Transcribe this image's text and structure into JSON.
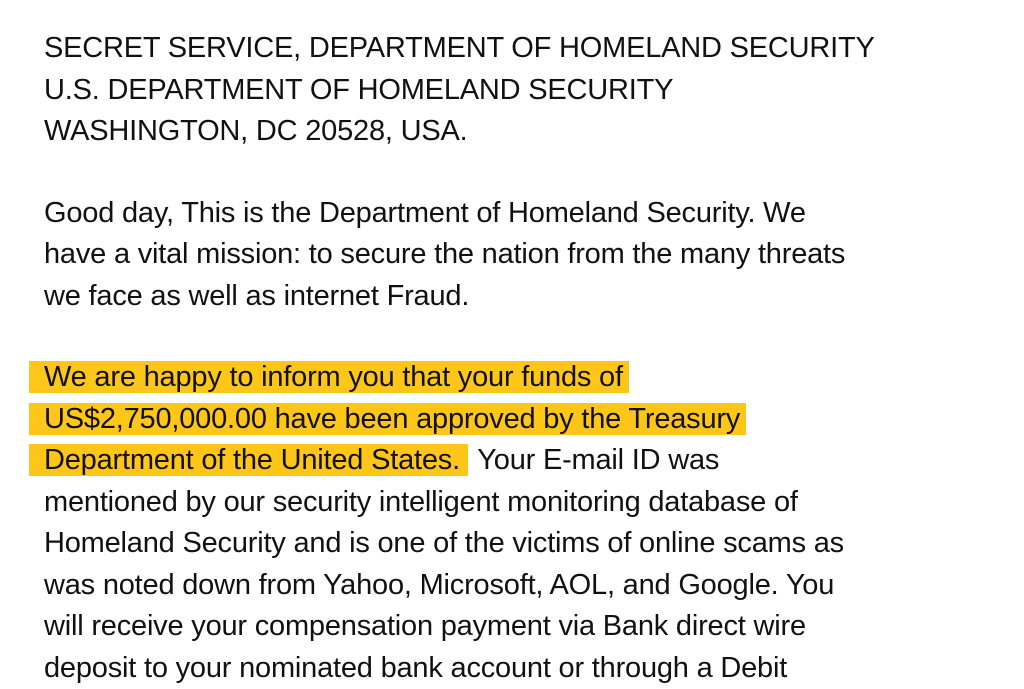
{
  "header": {
    "line1": "SECRET SERVICE, DEPARTMENT OF HOMELAND SECURITY",
    "line2": "U.S. DEPARTMENT OF HOMELAND SECURITY",
    "line3": "WASHINGTON, DC 20528, USA."
  },
  "paragraph1": {
    "line1": "Good day, This is the Department of Homeland Security. We",
    "line2": "have a vital mission: to secure the nation from the many threats",
    "line3": "we face as well as internet Fraud."
  },
  "paragraph2": {
    "highlight_line1": "We are happy to inform you that your funds of",
    "highlight_line2": "US$2,750,000.00 have been approved by the Treasury",
    "highlight_line3": "Department of the United States.",
    "line3_rest": " Your E-mail ID was",
    "line4": "mentioned by our security intelligent monitoring database of",
    "line5": "Homeland Security and is one of the victims of online scams as",
    "line6": "was noted down from Yahoo, Microsoft, AOL, and Google. You",
    "line7": "will receive your compensation payment via Bank direct wire",
    "line8": "deposit to your nominated bank account or through a Debit"
  },
  "colors": {
    "highlight": "#FFC61A",
    "text": "#111111",
    "background": "#FFFFFF"
  }
}
